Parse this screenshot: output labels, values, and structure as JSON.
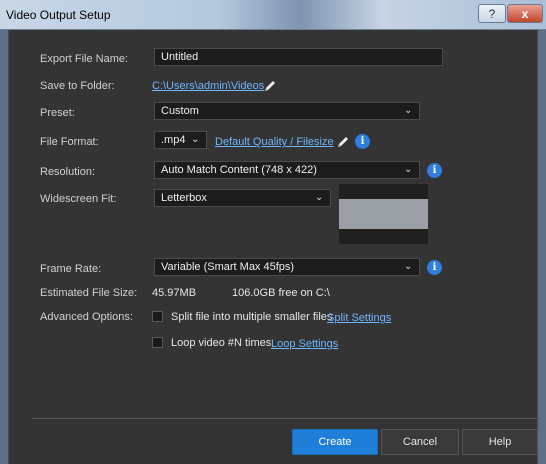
{
  "window": {
    "title": "Video Output Setup",
    "help_glyph": "?",
    "close_glyph": "x"
  },
  "form": {
    "export_file_name": {
      "label": "Export File Name:",
      "value": "Untitled"
    },
    "save_to_folder": {
      "label": "Save to Folder:",
      "path": "C:\\Users\\admin\\Videos"
    },
    "preset": {
      "label": "Preset:",
      "value": "Custom"
    },
    "file_format": {
      "label": "File Format:",
      "value": ".mp4",
      "quality_link": "Default Quality / Filesize"
    },
    "resolution": {
      "label": "Resolution:",
      "value": "Auto Match Content (748 x 422)"
    },
    "widescreen_fit": {
      "label": "Widescreen Fit:",
      "value": "Letterbox"
    },
    "frame_rate": {
      "label": "Frame Rate:",
      "value": "Variable (Smart Max 45fps)"
    },
    "estimated_file_size": {
      "label": "Estimated File Size:",
      "size": "45.97MB",
      "free_space": "106.0GB free on C:\\"
    },
    "advanced_options": {
      "label": "Advanced Options:",
      "split": {
        "text": "Split file into multiple smaller files",
        "link": "Split Settings",
        "checked": false
      },
      "loop": {
        "text": "Loop video #N times",
        "link": "Loop Settings",
        "checked": false
      }
    }
  },
  "buttons": {
    "create": "Create",
    "cancel": "Cancel",
    "help": "Help"
  },
  "icons": {
    "info": "i",
    "chevron": "⌄"
  },
  "colors": {
    "accent": "#1f7fd8",
    "link": "#6fb6ff",
    "dialog_bg": "#343434"
  }
}
